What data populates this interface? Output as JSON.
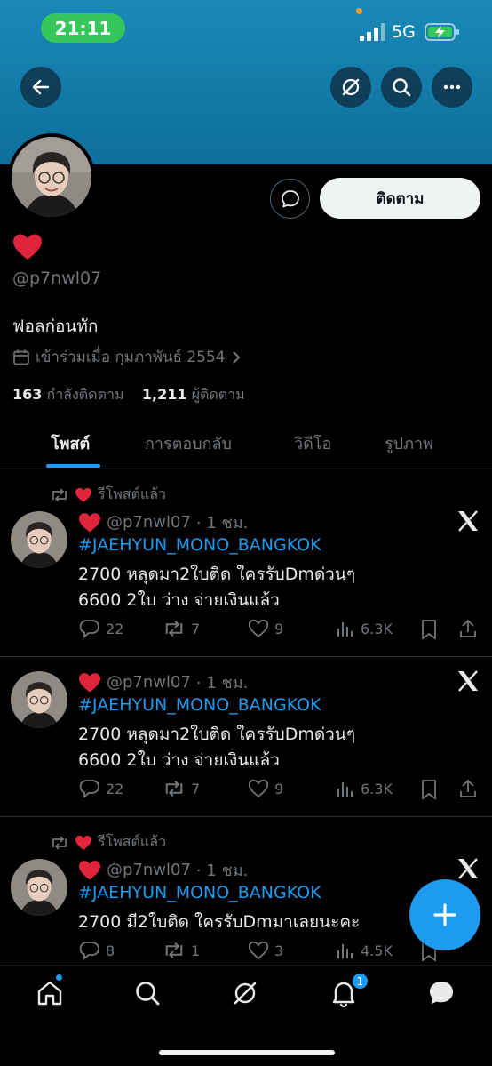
{
  "status_bar": {
    "time": "21:11",
    "network": "5G"
  },
  "profile": {
    "display_name_emoji": "❤️",
    "handle": "@p7nwl07",
    "bio": "ฟอลก่อนทัก",
    "joined": "เข้าร่วมเมื่อ กุมภาพันธ์ 2554",
    "following_count": "163",
    "following_label": "กำลังติดตาม",
    "followers_count": "1,211",
    "followers_label": "ผู้ติดตาม",
    "follow_label": "ติดตาม"
  },
  "tabs": [
    {
      "label": "โพสต์",
      "active": true
    },
    {
      "label": "การตอบกลับ",
      "active": false
    },
    {
      "label": "วิดีโอ",
      "active": false
    },
    {
      "label": "รูปภาพ",
      "active": false
    }
  ],
  "posts": [
    {
      "repost_label": "รีโพสต์แล้ว",
      "handle": "@p7nwl07",
      "time": "· 1 ชม.",
      "hashtag": "#JAEHYUN_MONO_BANGKOK",
      "line1": "2700 หลุดมา2ใบติด ใครรับDmด่วนๆ",
      "line2": "6600 2ใบ ว่าง จ่ายเงินแล้ว",
      "replies": "22",
      "reposts": "7",
      "likes": "9",
      "views": "6.3K"
    },
    {
      "repost_label": "",
      "handle": "@p7nwl07",
      "time": "· 1 ชม.",
      "hashtag": "#JAEHYUN_MONO_BANGKOK",
      "line1": "2700 หลุดมา2ใบติด ใครรับDmด่วนๆ",
      "line2": "6600 2ใบ ว่าง จ่ายเงินแล้ว",
      "replies": "22",
      "reposts": "7",
      "likes": "9",
      "views": "6.3K"
    },
    {
      "repost_label": "รีโพสต์แล้ว",
      "handle": "@p7nwl07",
      "time": "· 1 ชม.",
      "hashtag": "#JAEHYUN_MONO_BANGKOK",
      "line1": "2700 มี2ใบติด ใครรับDmมาเลยนะคะ",
      "line2": "",
      "replies": "8",
      "reposts": "1",
      "likes": "3",
      "views": "4.5K"
    }
  ],
  "bottom_nav": {
    "notification_count": "1"
  },
  "icons": {
    "back": "arrow-left-icon",
    "grok": "grok-icon",
    "search": "search-icon",
    "more": "more-icon",
    "message": "message-icon",
    "calendar": "calendar-icon",
    "repost": "repost-icon",
    "reply": "reply-icon",
    "like": "heart-icon",
    "views": "views-icon",
    "bookmark": "bookmark-icon",
    "share": "share-icon",
    "x_logo": "x-logo-icon",
    "compose": "plus-icon",
    "home": "home-icon",
    "notifications": "bell-icon",
    "messages": "chat-icon"
  },
  "colors": {
    "accent": "#1d9bf0",
    "banner": "#1a89b7",
    "status_pill": "#35c759"
  }
}
